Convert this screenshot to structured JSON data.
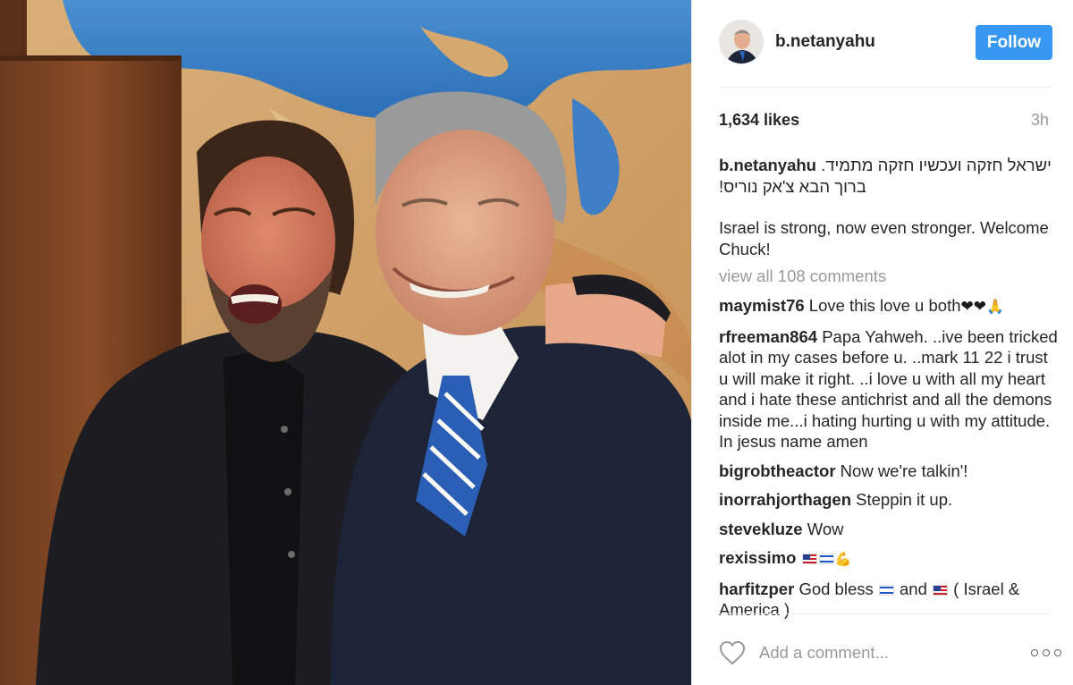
{
  "post": {
    "username": "b.netanyahu",
    "follow_label": "Follow",
    "likes": "1,634 likes",
    "time": "3h",
    "caption": {
      "user": "b.netanyahu",
      "hebrew": "ישראל חזקה ועכשיו חזקה מתמיד. ברוך הבא צ'אק נוריס!",
      "english": "Israel is strong, now even stronger. Welcome Chuck!"
    },
    "view_all_comments": "view all 108 comments",
    "comments": [
      {
        "user": "maymist76",
        "text": "Love this love u both"
      },
      {
        "user": "rfreeman864",
        "text": "Papa Yahweh. ..ive been tricked alot in my cases before u. ..mark 11 22 i trust u will make it right. ..i love u with all my heart and i hate these antichrist and all the demons inside me...i hating hurting u with my attitude. In jesus name amen"
      },
      {
        "user": "bigrobtheactor",
        "text": "Now we're talkin'!"
      },
      {
        "user": "inorrahjorthagen",
        "text": "Steppin it up."
      },
      {
        "user": "stevekluze",
        "text": "Wow"
      },
      {
        "user": "rexissimo",
        "text": ""
      },
      {
        "user": "harfitzper",
        "text_a": "God bless",
        "text_b": "and",
        "text_c": "( Israel & America )"
      }
    ],
    "add_comment_placeholder": "Add a comment..."
  },
  "icons": {
    "heart": "heart-outline-icon",
    "more": "more-options-icon",
    "flag_us": "us-flag-emoji",
    "flag_il": "israel-flag-emoji"
  },
  "colors": {
    "follow_button": "#3897f0",
    "secondary_text": "#999999",
    "primary_text": "#262626"
  }
}
